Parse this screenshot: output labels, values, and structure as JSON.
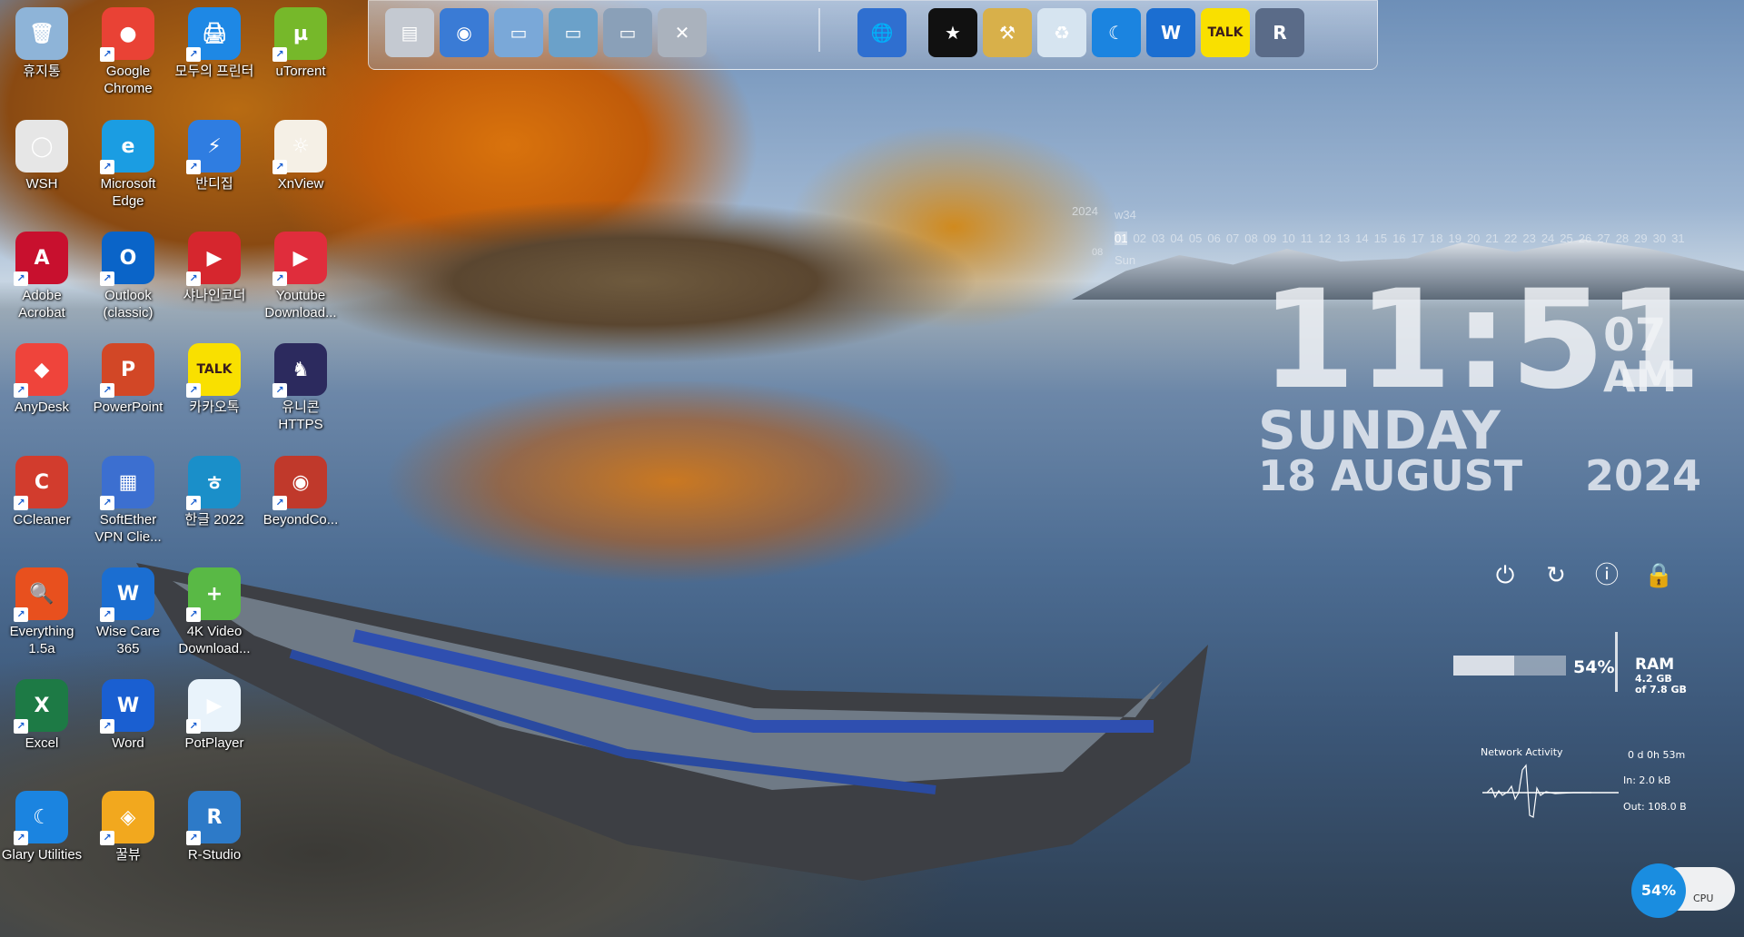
{
  "desktop_icons": [
    {
      "label": "휴지통",
      "color": "#8eb4d8",
      "glyph": "🗑"
    },
    {
      "label": "Google Chrome",
      "color": "#e94235",
      "glyph": "●"
    },
    {
      "label": "모두의 프린터",
      "color": "#1e88e5",
      "glyph": "🖨"
    },
    {
      "label": "uTorrent",
      "color": "#76b82a",
      "glyph": "µ"
    },
    {
      "label": "WSH",
      "color": "#e6e6e6",
      "glyph": "◯"
    },
    {
      "label": "Microsoft Edge",
      "color": "#1b9de2",
      "glyph": "e"
    },
    {
      "label": "반디집",
      "color": "#2f7de1",
      "glyph": "⚡"
    },
    {
      "label": "XnView",
      "color": "#f5f0e6",
      "glyph": "☼"
    },
    {
      "label": "Adobe Acrobat",
      "color": "#c8102e",
      "glyph": "A"
    },
    {
      "label": "Outlook (classic)",
      "color": "#0a64c8",
      "glyph": "O"
    },
    {
      "label": "샤나인코더",
      "color": "#d6262e",
      "glyph": "▶"
    },
    {
      "label": "Youtube Download...",
      "color": "#e02d3c",
      "glyph": "▶"
    },
    {
      "label": "AnyDesk",
      "color": "#ef443b",
      "glyph": "◆"
    },
    {
      "label": "PowerPoint",
      "color": "#d24726",
      "glyph": "P"
    },
    {
      "label": "카카오톡",
      "color": "#f9e000",
      "glyph": "TALK"
    },
    {
      "label": "유니콘 HTTPS",
      "color": "#2c2a5e",
      "glyph": "♞"
    },
    {
      "label": "CCleaner",
      "color": "#d23c2d",
      "glyph": "C"
    },
    {
      "label": "SoftEther VPN Clie...",
      "color": "#3c6fd0",
      "glyph": "▦"
    },
    {
      "label": "한글 2022",
      "color": "#1a8fc9",
      "glyph": "ㅎ"
    },
    {
      "label": "BeyondCo...",
      "color": "#c0392b",
      "glyph": "◉"
    },
    {
      "label": "Everything 1.5a",
      "color": "#e8501e",
      "glyph": "🔍"
    },
    {
      "label": "Wise Care 365",
      "color": "#1b6ed1",
      "glyph": "W"
    },
    {
      "label": "4K Video Download...",
      "color": "#59b945",
      "glyph": "+"
    },
    {
      "label": "Excel",
      "color": "#1d7a45",
      "glyph": "X"
    },
    {
      "label": "Word",
      "color": "#1a5fd1",
      "glyph": "W"
    },
    {
      "label": "PotPlayer",
      "color": "#e9f3fb",
      "glyph": "▶"
    },
    {
      "label": "Glary Utilities",
      "color": "#1b84e0",
      "glyph": "☾"
    },
    {
      "label": "꿀뷰",
      "color": "#f2a81e",
      "glyph": "◈"
    },
    {
      "label": "R-Studio",
      "color": "#2d7ac8",
      "glyph": "R"
    }
  ],
  "dock": {
    "items": [
      {
        "name": "notepad",
        "color": "#c4c9d1",
        "glyph": "▤"
      },
      {
        "name": "network",
        "color": "#3a7bd5",
        "glyph": "◉"
      },
      {
        "name": "folder-1",
        "color": "#7aa8d8",
        "glyph": "▭"
      },
      {
        "name": "folder-2",
        "color": "#6ba1c9",
        "glyph": "▭"
      },
      {
        "name": "folder-3",
        "color": "#8aa0b8",
        "glyph": "▭"
      },
      {
        "name": "tools",
        "color": "#aab2bd",
        "glyph": "✕"
      },
      {
        "name": "globe",
        "color": "#2f6fd0",
        "glyph": "🌐"
      },
      {
        "name": "tshirt",
        "color": "#111111",
        "glyph": "★"
      },
      {
        "name": "hammer",
        "color": "#d8b04a",
        "glyph": "⚒"
      },
      {
        "name": "recycle",
        "color": "#d6e4f0",
        "glyph": "♻"
      },
      {
        "name": "glary",
        "color": "#1b84e0",
        "glyph": "☾"
      },
      {
        "name": "wise",
        "color": "#1b6ed1",
        "glyph": "W"
      },
      {
        "name": "kakaotalk",
        "color": "#f9e000",
        "glyph": "TALK"
      },
      {
        "name": "registry",
        "color": "#5a6b88",
        "glyph": "R"
      }
    ]
  },
  "calendar": {
    "year": "2024",
    "week": "w34",
    "month": "08",
    "weekday": "Sun",
    "days": [
      "01",
      "02",
      "03",
      "04",
      "05",
      "06",
      "07",
      "08",
      "09",
      "10",
      "11",
      "12",
      "13",
      "14",
      "15",
      "16",
      "17",
      "18",
      "19",
      "20",
      "21",
      "22",
      "23",
      "24",
      "25",
      "26",
      "27",
      "28",
      "29",
      "30",
      "31"
    ]
  },
  "clock": {
    "time": "11:51",
    "seconds": "07",
    "ampm": "AM",
    "day": "SUNDAY",
    "date": "18 AUGUST",
    "year": "2024"
  },
  "power_buttons": [
    {
      "name": "power-icon",
      "glyph": "⏻"
    },
    {
      "name": "restart-icon",
      "glyph": "↻"
    },
    {
      "name": "sleep-icon",
      "glyph": "ⓘ"
    },
    {
      "name": "lock-icon",
      "glyph": "🔒"
    }
  ],
  "ram": {
    "percent_text": "54%",
    "percent_value": 54,
    "label": "RAM",
    "used": "4.2 GB",
    "total": "of 7.8 GB"
  },
  "network": {
    "title": "Network Activity",
    "uptime": "0 d 0h 53m",
    "in": "In: 2.0 kB",
    "out": "Out: 108.0 B"
  },
  "cpu": {
    "percent_text": "54%",
    "label": "CPU"
  }
}
